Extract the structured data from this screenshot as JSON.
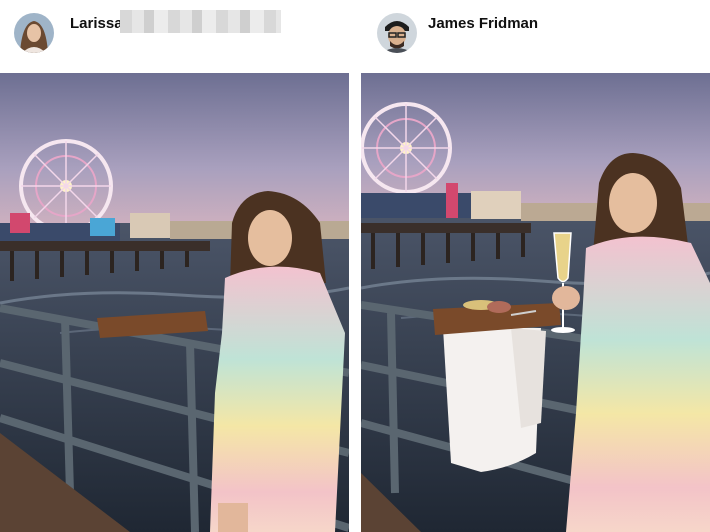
{
  "posts": [
    {
      "username": "Larissa",
      "avatar": "profile-photo-woman",
      "name_redacted": true
    },
    {
      "username": "James Fridman",
      "avatar": "profile-photo-man-with-glasses"
    }
  ],
  "colors": {
    "sky_top": "#6d6f92",
    "sky_bottom": "#c9a7b8",
    "ocean": "#2f3a4d",
    "railing": "#5a6670",
    "tray": "#7a4a2a",
    "napkin": "#f4f1ef"
  }
}
